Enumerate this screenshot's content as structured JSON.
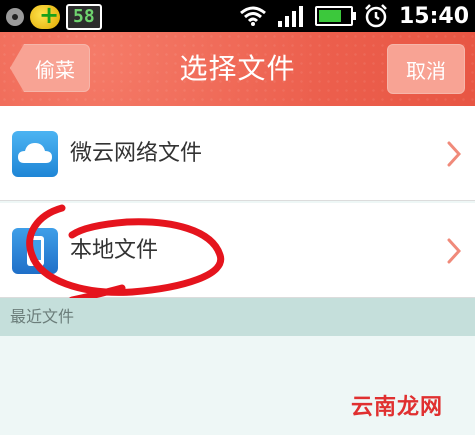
{
  "status_bar": {
    "badge": "58",
    "time": "15:40",
    "battery_level": 0.72,
    "icons": [
      "record-icon",
      "plus-app-icon",
      "wifi-icon",
      "signal-icon",
      "battery-icon",
      "alarm-icon"
    ]
  },
  "title_bar": {
    "back_label": "偷菜",
    "title": "选择文件",
    "cancel_label": "取消"
  },
  "items": [
    {
      "label": "微云网络文件",
      "icon": "cloud-icon"
    },
    {
      "label": "本地文件",
      "icon": "phone-icon"
    }
  ],
  "section": {
    "label": "最近文件"
  },
  "watermark": "云南龙网",
  "colors": {
    "title_bar": "#ec5f4d",
    "section_header": "#c5dfdb",
    "annotation": "#e5141d",
    "chevron": "#f08a7a"
  }
}
